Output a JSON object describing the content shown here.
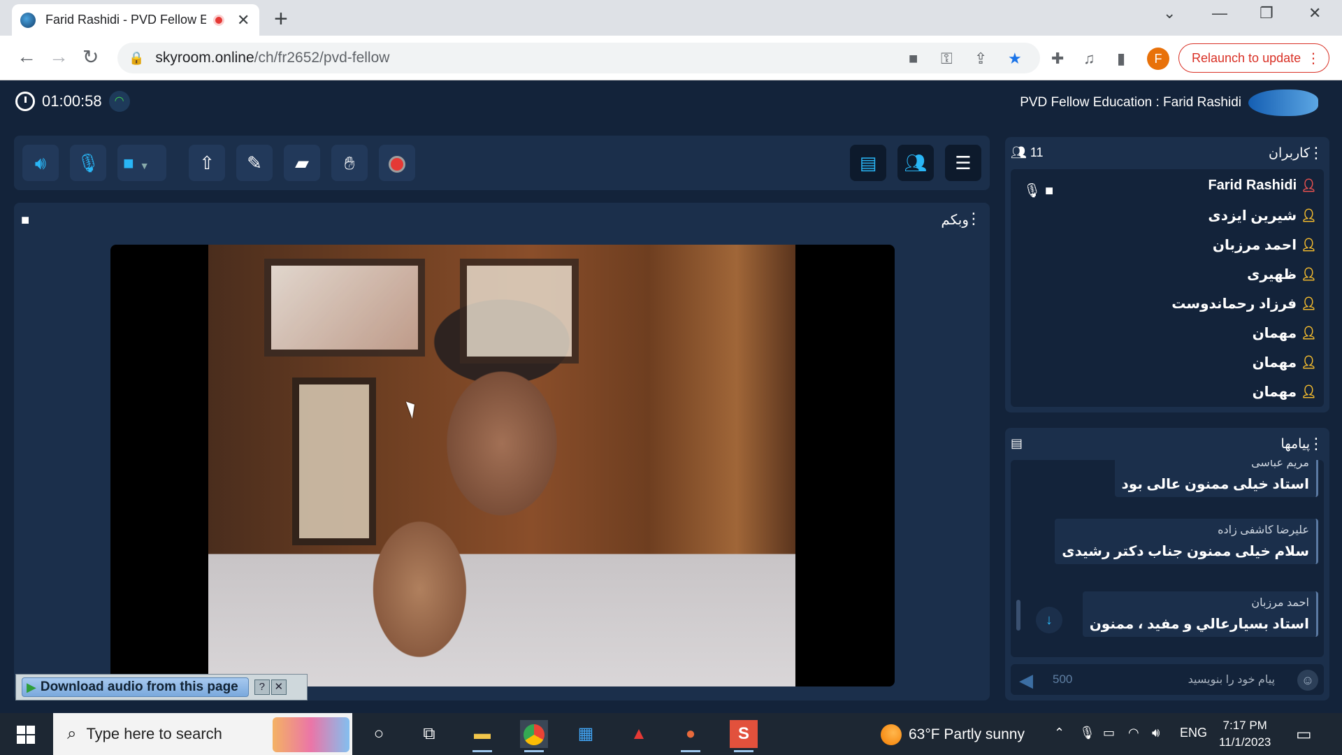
{
  "browser": {
    "tab_title": "Farid Rashidi - PVD Fellow Ec",
    "tab_close": "✕",
    "new_tab": "+",
    "url_host": "skyroom.online",
    "url_path": "/ch/fr2652/pvd-fellow",
    "profile_initial": "F",
    "relaunch_label": "Relaunch to update"
  },
  "header": {
    "timer": "01:00:58",
    "room_title": "PVD Fellow Education : Farid Rashidi"
  },
  "webcam": {
    "label": "وبکم"
  },
  "users": {
    "title": "کاربران",
    "count": "11",
    "list": [
      "Farid Rashidi",
      "شیرین ایزدی",
      "احمد مرزبان",
      "ظهیری",
      "فرزاد رحماندوست",
      "مهمان",
      "مهمان",
      "مهمان"
    ]
  },
  "messages": {
    "title": "پیامها",
    "items": [
      {
        "sender": "مریم عباسی",
        "text": "استاد خیلی ممنون عالی بود"
      },
      {
        "sender": "علیرضا کاشفی زاده",
        "text": "سلام خیلی ممنون جناب دکتر رشیدی"
      },
      {
        "sender": "احمد مرزبان",
        "text": "استاد بسیارعالي و مفيد ، ممنون"
      }
    ],
    "char_count": "500",
    "input_placeholder": "پیام خود را بنویسید"
  },
  "download_bar": {
    "label": "Download audio from this page",
    "help": "?",
    "close": "✕"
  },
  "taskbar": {
    "search_placeholder": "Type here to search",
    "weather": "63°F  Partly sunny",
    "lang": "ENG",
    "time": "7:17 PM",
    "date": "11/1/2023"
  }
}
